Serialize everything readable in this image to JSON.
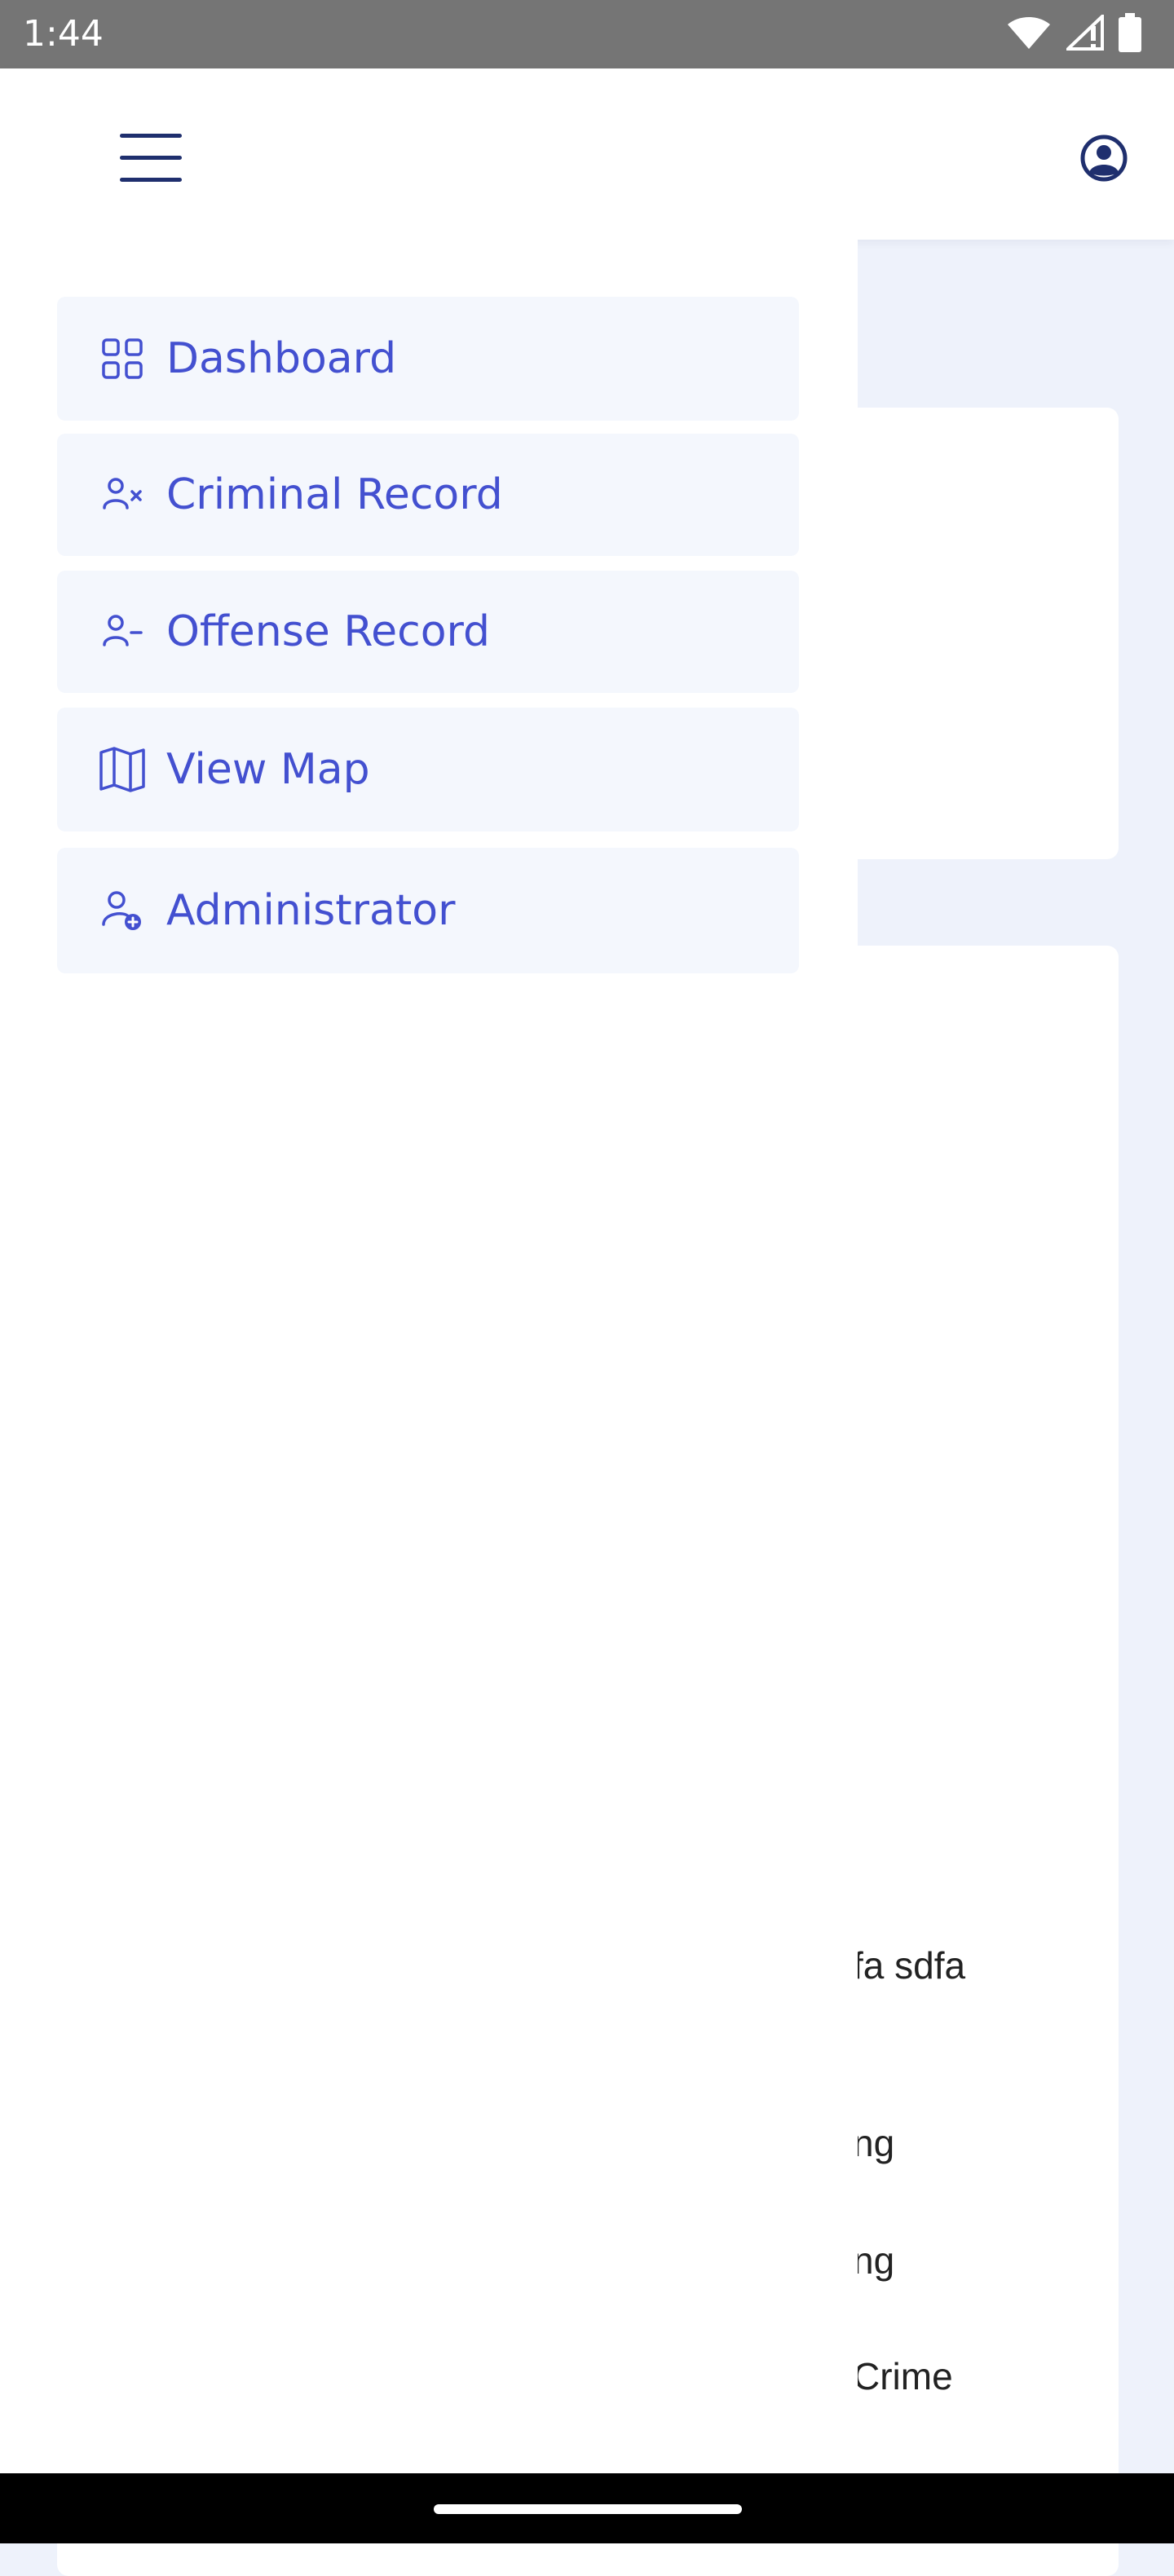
{
  "status_bar": {
    "time": "1:44",
    "icons": [
      "wifi-icon",
      "signal-icon",
      "battery-icon"
    ]
  },
  "header": {
    "menu_icon": "hamburger-menu-icon",
    "profile_icon": "user-account-icon"
  },
  "drawer": {
    "items": [
      {
        "label": "Dashboard",
        "icon": "grid-icon"
      },
      {
        "label": "Criminal Record",
        "icon": "user-x-icon"
      },
      {
        "label": "Offense Record",
        "icon": "user-minus-icon"
      },
      {
        "label": "View Map",
        "icon": "map-icon"
      },
      {
        "label": "Administrator",
        "icon": "user-plus-icon"
      }
    ]
  },
  "background_content": {
    "fragments": [
      "fa sdfa",
      "ng",
      "ng",
      "Crime"
    ]
  },
  "colors": {
    "accent": "#4350d0",
    "nav_item_bg": "#f4f7fd",
    "page_bg": "#eef2fb",
    "header_icon": "#1f2f6e"
  }
}
